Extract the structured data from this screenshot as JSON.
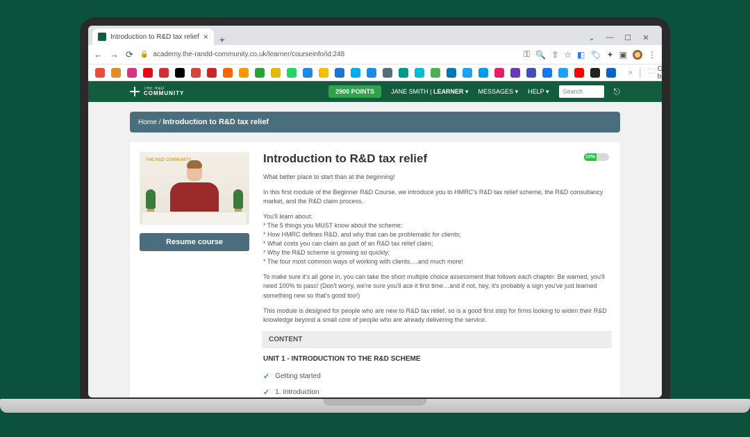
{
  "browser": {
    "tab_title": "Introduction to R&D tax relief",
    "url": "academy.the-randd-community.co.uk/learner/courseinfo/id:248",
    "other_bookmarks": "Other bookmarks",
    "bookmark_colors": [
      "#e84e3c",
      "#e08e2b",
      "#d63384",
      "#e50914",
      "#d32f2f",
      "#000000",
      "#d44638",
      "#c62828",
      "#ff6600",
      "#ff9800",
      "#2aa038",
      "#e6b800",
      "#25d366",
      "#1e88e5",
      "#fbbc05",
      "#1976d2",
      "#03a9f4",
      "#1e88e5",
      "#546e7a",
      "#009688",
      "#00bcd4",
      "#4caf50",
      "#0077b5",
      "#1da1f2",
      "#039be5",
      "#e91e63",
      "#673ab7",
      "#3f51b5",
      "#1877f2",
      "#1da1f2",
      "#ff0000",
      "#222222",
      "#0b66c3"
    ]
  },
  "topbar": {
    "brand_line1": "THE R&D",
    "brand_line2": "COMMUNITY",
    "points": "2900 POINTS",
    "user": "JANE SMITH",
    "role": "LEARNER",
    "messages": "MESSAGES",
    "help": "HELP",
    "search_placeholder": "Search"
  },
  "breadcrumb": {
    "home": "Home",
    "current": "Introduction to R&D tax relief"
  },
  "thumb_brand": "THE R&D\nCOMMUNITY",
  "resume_label": "Resume course",
  "course": {
    "title": "Introduction to R&D tax relief",
    "progress_label": "10%",
    "p1": "What better place to start than at the beginning!",
    "p2": "In this first module of the Beginner R&D Course, we introduce you to HMRC's R&D tax relief scheme, the R&D consultancy market, and the R&D claim process.",
    "p3": "You'll learn about:",
    "b1": "* The 5 things you MUST know about the scheme;",
    "b2": "* How HMRC defines R&D, and why that can be problematic for clients;",
    "b3": "* What costs you can claim as part of an R&D tax relief claim;",
    "b4": "* Why the R&D scheme is growing so quickly;",
    "b5": "* The four most common ways of working with clients….and much more!",
    "p4": "To make sure it's all gone in, you can take the short multiple choice assessment that follows each chapter. Be warned, you'll need 100% to pass! (Don't worry, we're sure you'll ace it first time…and if not, hey, it's probably a sign you've just learned something new so that's good too!)",
    "p5": "This module is designed for people who are new to R&D tax relief, so is a good first step for firms looking to widen their R&D knowledge beyond a small core of people who are already delivering the service."
  },
  "content_header": "CONTENT",
  "unit_title": "UNIT 1 - INTRODUCTION TO THE R&D SCHEME",
  "lessons": [
    "Getting started",
    "1. Introduction"
  ]
}
